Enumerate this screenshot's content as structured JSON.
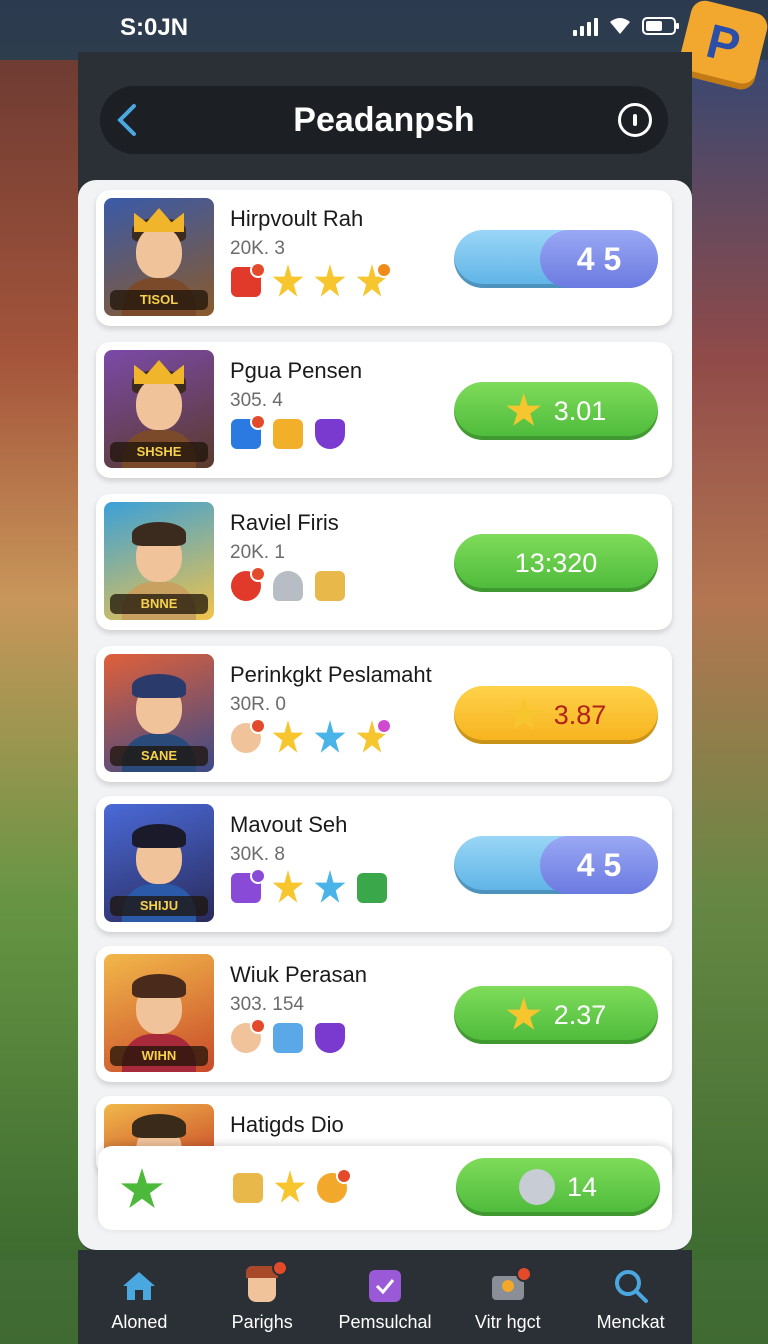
{
  "status_bar": {
    "time": "S:0JN"
  },
  "header": {
    "title": "Peadanpsh"
  },
  "rows": [
    {
      "name": "Hirpvoult Rah",
      "score": "20K. 3",
      "tag": "TISOL",
      "pill": {
        "style": "toggle",
        "value": "4 5"
      },
      "badges": [
        "red-box-icon",
        "star-icon",
        "star-icon",
        "star-icon"
      ]
    },
    {
      "name": "Pgua Pensen",
      "score": "305. 4",
      "tag": "SHSHE",
      "pill": {
        "style": "green",
        "value": "3.01",
        "icon": "star-icon"
      },
      "badges": [
        "blue-box-icon",
        "yellow-box-icon",
        "purple-gem-icon"
      ]
    },
    {
      "name": "Raviel Firis",
      "score": "20K. 1",
      "tag": "BNNE",
      "pill": {
        "style": "green",
        "value": "13:320"
      },
      "badges": [
        "red-target-icon",
        "grey-shoe-icon",
        "gold-block-icon"
      ]
    },
    {
      "name": "Perinkgkt Peslamaht",
      "score": "30R. 0",
      "tag": "SANE",
      "pill": {
        "style": "yellow",
        "value": "3.87",
        "icon": "star-icon"
      },
      "badges": [
        "face-icon",
        "star-icon",
        "blue-star-icon",
        "star-icon"
      ]
    },
    {
      "name": "Mavout Seh",
      "score": "30K. 8",
      "tag": "SHIJU",
      "pill": {
        "style": "toggle",
        "value": "4 5"
      },
      "badges": [
        "purple-check-icon",
        "star-icon",
        "blue-star-icon",
        "money-icon"
      ]
    },
    {
      "name": "Wiuk Perasan",
      "score": "303. 154",
      "tag": "WIHN",
      "pill": {
        "style": "green",
        "value": "2.37",
        "icon": "star-icon"
      },
      "badges": [
        "face-icon",
        "blue-gift-icon",
        "purple-gem-icon"
      ]
    },
    {
      "name": "Hatigds Dio"
    }
  ],
  "footer": {
    "pill_value": "14"
  },
  "nav": [
    {
      "label": "Aloned",
      "icon": "home-icon"
    },
    {
      "label": "Parighs",
      "icon": "profile-icon"
    },
    {
      "label": "Pemsulchal",
      "icon": "check-box-icon"
    },
    {
      "label": "Vitr hgct",
      "icon": "chest-icon"
    },
    {
      "label": "Menckat",
      "icon": "search-icon"
    }
  ],
  "colors": {
    "green": "#4cb93a",
    "yellow": "#f6b21c",
    "blue": "#5cb2e6",
    "panel": "#2b2f36"
  }
}
